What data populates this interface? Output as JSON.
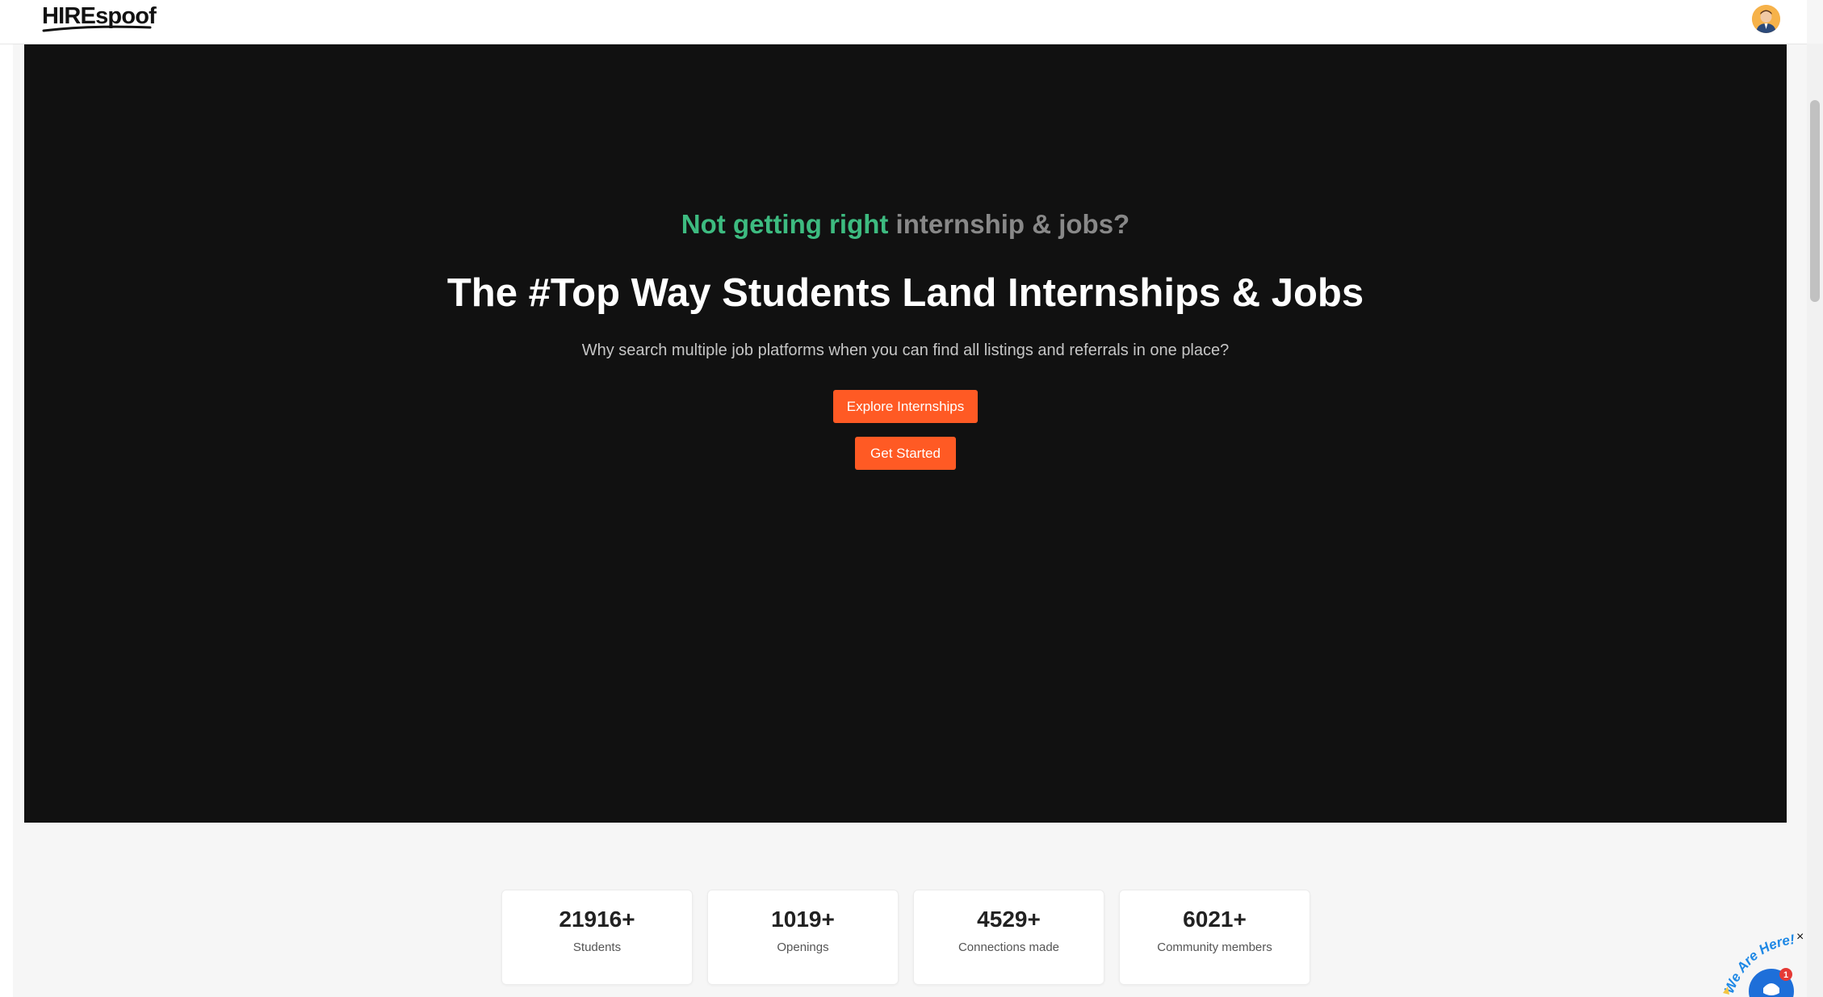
{
  "navbar": {
    "logo_text": "HIREspoof"
  },
  "hero": {
    "tagline_part1": "Not getting right",
    "tagline_part2": "internship & jobs?",
    "title": "The #Top Way Students Land Internships & Jobs",
    "subtitle": "Why search multiple job platforms when you can find all listings and referrals in one place?",
    "explore_button": "Explore Internships",
    "start_button": "Get Started"
  },
  "stats": [
    {
      "value": "21916+",
      "label": "Students"
    },
    {
      "value": "1019+",
      "label": "Openings"
    },
    {
      "value": "4529+",
      "label": "Connections made"
    },
    {
      "value": "6021+",
      "label": "Community members"
    }
  ],
  "chat_widget": {
    "badge_text": "We Are Here!",
    "notification_count": "1",
    "close_symbol": "×"
  },
  "colors": {
    "accent": "#ff5a24",
    "tagline_green": "#3dbb80",
    "hero_background": "#111111"
  }
}
